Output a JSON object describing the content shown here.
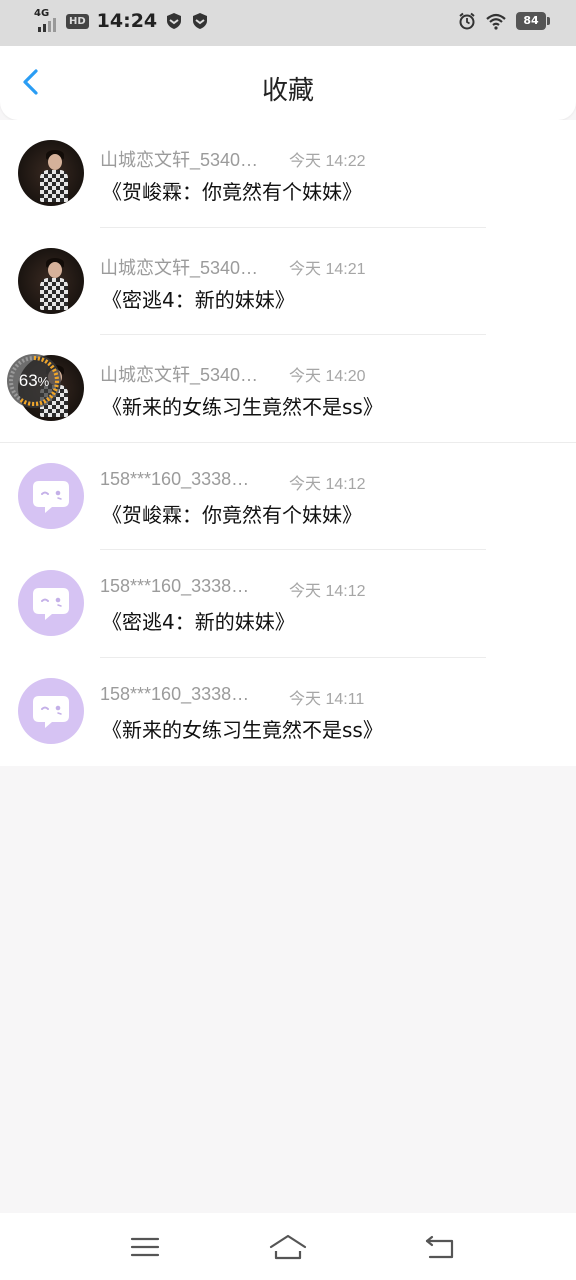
{
  "status_bar": {
    "network": "4G",
    "hd": "HD",
    "time": "14:24",
    "battery": "84"
  },
  "header": {
    "title": "收藏",
    "back_icon": "chevron-left-icon"
  },
  "upload_progress": {
    "percent": "63",
    "unit": "%",
    "fraction": 0.63
  },
  "favorites": [
    {
      "sender": "山城恋文轩_5340…",
      "time": "今天 14:22",
      "title": "《贺峻霖：你竟然有个妹妹》",
      "avatar": "photo"
    },
    {
      "sender": "山城恋文轩_5340…",
      "time": "今天 14:21",
      "title": "《密逃4：新的妹妹》",
      "avatar": "photo"
    },
    {
      "sender": "山城恋文轩_5340…",
      "time": "今天 14:20",
      "title": "《新来的女练习生竟然不是ss》",
      "avatar": "photo"
    },
    {
      "sender": "158***160_3338…",
      "time": "今天 14:12",
      "title": "《贺峻霖：你竟然有个妹妹》",
      "avatar": "bot"
    },
    {
      "sender": "158***160_3338…",
      "time": "今天 14:12",
      "title": "《密逃4：新的妹妹》",
      "avatar": "bot"
    },
    {
      "sender": "158***160_3338…",
      "time": "今天 14:11",
      "title": "《新来的女练习生竟然不是ss》",
      "avatar": "bot"
    }
  ],
  "colors": {
    "accent": "#2a9df4",
    "bot_avatar": "#d6c3f3",
    "progress": "#f5a623"
  },
  "nav": {
    "menu_icon": "menu-icon",
    "home_icon": "home-icon",
    "back_icon": "back-icon"
  }
}
